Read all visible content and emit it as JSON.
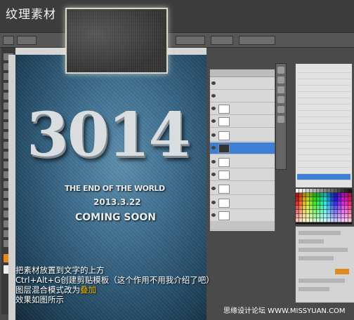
{
  "heading": "纹理素材",
  "poster": {
    "year": "3014",
    "tagline": "THE END OF THE WORLD",
    "date": "2013.3.22",
    "coming": "COMING SOON"
  },
  "caption": {
    "line1": "把素材放置到文字的上方",
    "line2": "Ctrl+Alt+G创建剪贴模板（这个作用不用我介绍了吧）",
    "line3_prefix": "图层混合模式改为",
    "line3_highlight": "叠加",
    "line4": "效果如图所示"
  },
  "watermark": "思缘设计论坛 WWW.MISSYUAN.COM",
  "colors": {
    "highlight": "#f0b000",
    "selected_layer": "#3d7fd4",
    "canvas_bg": "#3f6f8f"
  }
}
